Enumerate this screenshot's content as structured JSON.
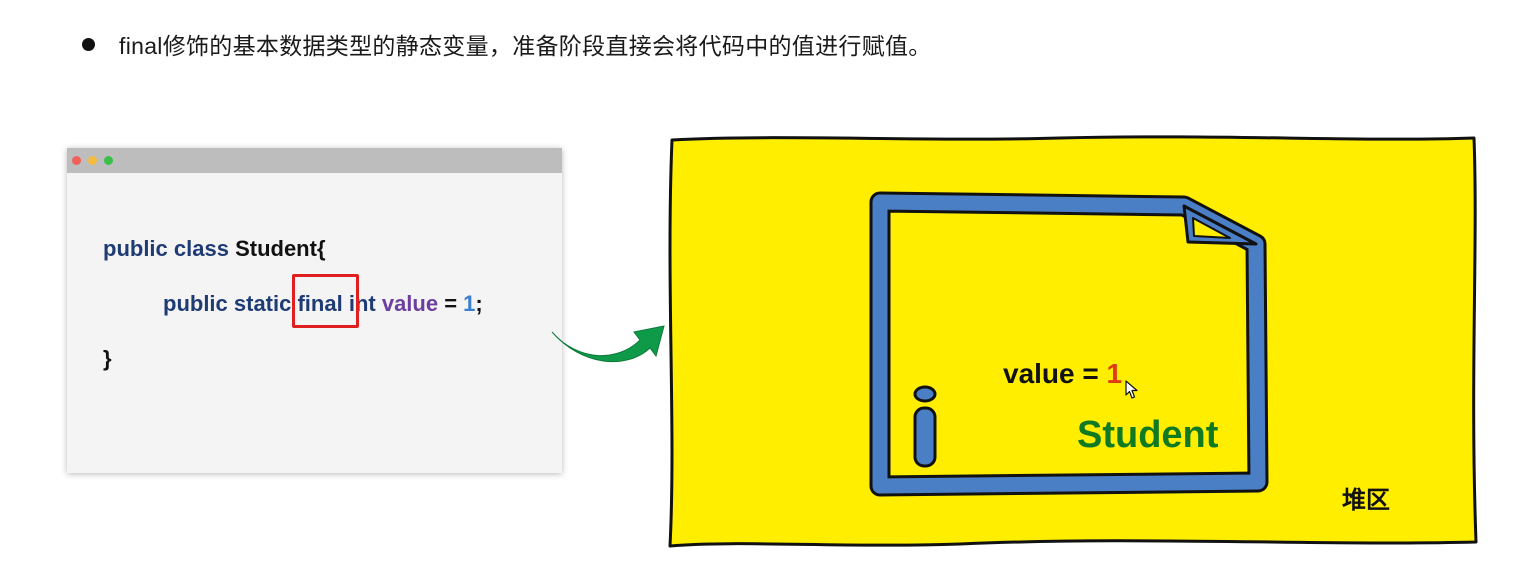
{
  "bullet": {
    "text": "final修饰的基本数据类型的静态变量，准备阶段直接会将代码中的值进行赋值。"
  },
  "code": {
    "line1": {
      "kw": "public class ",
      "name": "Student{"
    },
    "line2": {
      "kw1": "public static ",
      "kw2": "final",
      "kw3": " int ",
      "ident": "value",
      "eq": " = ",
      "num": "1",
      "semi": ";"
    },
    "line3": "}"
  },
  "heap": {
    "value_label": "value = ",
    "value_number": "1",
    "class_name": "Student",
    "area_label": "堆区"
  },
  "colors": {
    "heap_background": "#ffee00",
    "object_border": "#4a7fc6",
    "highlight": "#e02020",
    "arrow": "#0f9a4a",
    "class_name": "#0f7a22",
    "keyword": "#1f3b73",
    "identifier": "#6b3fa0",
    "number": "#3a7fd0"
  }
}
